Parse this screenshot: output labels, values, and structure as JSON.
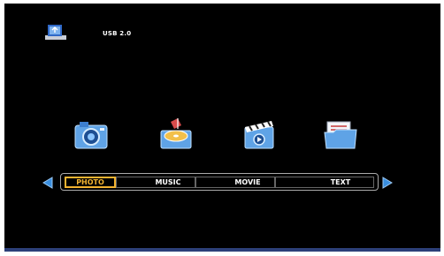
{
  "device": {
    "source_label": "USB 2.0",
    "icon": "usb-drive-icon"
  },
  "menu": {
    "selected_index": 0,
    "tabs": [
      {
        "label": "PHOTO",
        "icon": "camera-icon"
      },
      {
        "label": "MUSIC",
        "icon": "music-disc-icon"
      },
      {
        "label": "MOVIE",
        "icon": "clapperboard-icon"
      },
      {
        "label": "TEXT",
        "icon": "folder-icon"
      }
    ]
  },
  "colors": {
    "background": "#000000",
    "accent": "#f3b331",
    "arrow": "#3a8fe0",
    "bottom_strip": "#2c3f78"
  }
}
